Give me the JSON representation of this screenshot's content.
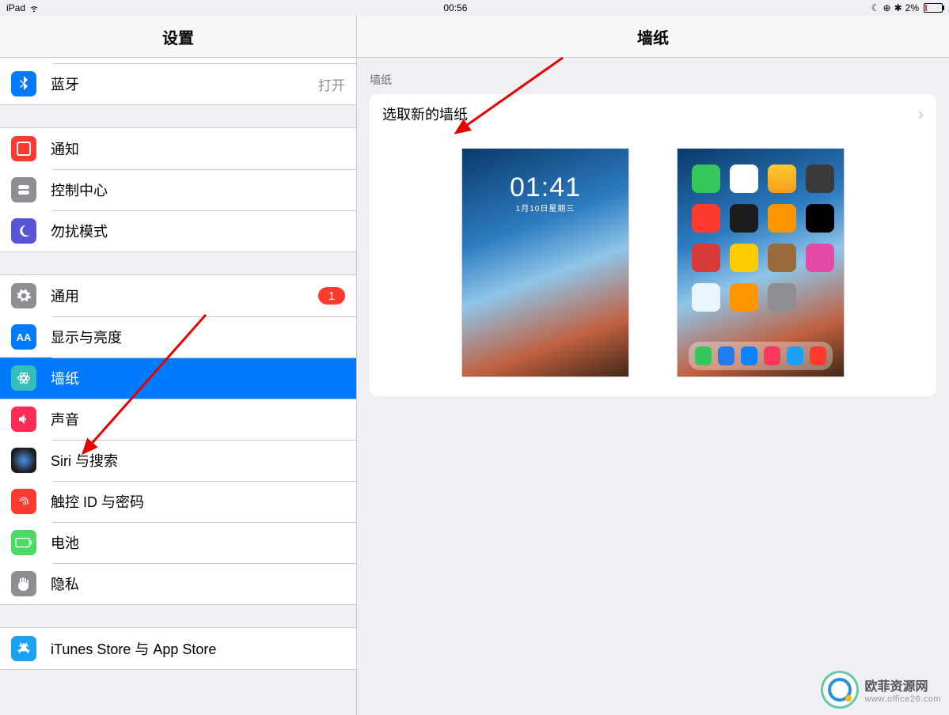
{
  "statusbar": {
    "device": "iPad",
    "time": "00:56",
    "battery_pct": "2%"
  },
  "sidebar": {
    "title": "设置",
    "groups": [
      {
        "rows": [
          {
            "id": "bluetooth",
            "label": "蓝牙",
            "value": "打开",
            "icon_bg": "#007aff"
          }
        ]
      },
      {
        "rows": [
          {
            "id": "notifications",
            "label": "通知",
            "icon_bg": "#ff3b30"
          },
          {
            "id": "control-center",
            "label": "控制中心",
            "icon_bg": "#8e8e93"
          },
          {
            "id": "dnd",
            "label": "勿扰模式",
            "icon_bg": "#5856d6"
          }
        ]
      },
      {
        "rows": [
          {
            "id": "general",
            "label": "通用",
            "icon_bg": "#8e8e93",
            "badge": "1"
          },
          {
            "id": "display",
            "label": "显示与亮度",
            "icon_bg": "#007aff"
          },
          {
            "id": "wallpaper",
            "label": "墙纸",
            "icon_bg": "#36bfb8",
            "selected": true
          },
          {
            "id": "sound",
            "label": "声音",
            "icon_bg": "#ff2d55"
          },
          {
            "id": "siri",
            "label": "Siri 与搜索",
            "icon_bg": "#1c1c1e"
          },
          {
            "id": "touchid",
            "label": "触控 ID 与密码",
            "icon_bg": "#ff3b30"
          },
          {
            "id": "battery",
            "label": "电池",
            "icon_bg": "#4cd964"
          },
          {
            "id": "privacy",
            "label": "隐私",
            "icon_bg": "#8e8e93"
          }
        ]
      },
      {
        "rows": [
          {
            "id": "itunes",
            "label": "iTunes Store 与 App Store",
            "icon_bg": "#1ba1f3"
          }
        ]
      }
    ]
  },
  "detail": {
    "title": "墙纸",
    "section_label": "墙纸",
    "choose_label": "选取新的墙纸",
    "lock_preview": {
      "time": "01:41",
      "date": "1月10日星期三"
    }
  },
  "watermark": {
    "name": "欧菲资源网",
    "url": "www.office26.com"
  }
}
